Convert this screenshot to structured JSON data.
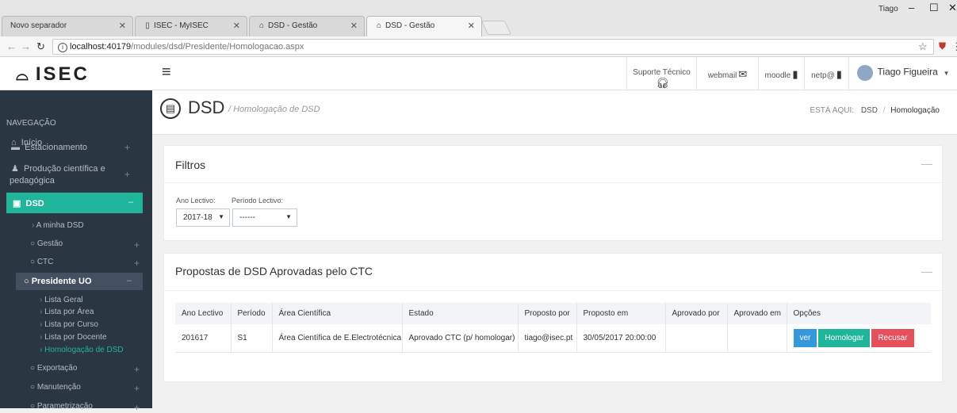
{
  "browser": {
    "tabs": [
      {
        "label": "Novo separador",
        "icon": ""
      },
      {
        "label": "ISEC - MyISEC",
        "icon": "page-icon"
      },
      {
        "label": "DSD - Gestão",
        "icon": "isec-logo-icon"
      },
      {
        "label": "DSD - Gestão",
        "icon": "isec-logo-icon"
      }
    ],
    "window_user": "Tiago",
    "url_host": "localhost:40179",
    "url_path": "/modules/dsd/Presidente/Homologacao.aspx"
  },
  "header": {
    "logo_text": "ISEC",
    "suporte": "Suporte Técnico",
    "webmail": "webmail",
    "moodle": "moodle",
    "netp": "netp@",
    "user_name": "Tiago Figueira"
  },
  "sidebar": {
    "heading": "NAVEGAÇÃO",
    "inicio": "Início",
    "estacionamento": "Estacionamento",
    "producao_line1": "Produção científica e",
    "producao_line2": "pedagógica",
    "dsd": "DSD",
    "minha_dsd": "A minha DSD",
    "gestao": "Gestão",
    "ctc": "CTC",
    "presidente": "Presidente UO",
    "sub": [
      "Lista Geral",
      "Lista por Área",
      "Lista por Curso",
      "Lista por Docente",
      "Homologação de DSD"
    ],
    "exportacao": "Exportação",
    "manutencao": "Manutenção",
    "parametrizacao": "Parametrização"
  },
  "page": {
    "title": "DSD",
    "subtitle": "/  Homologação de DSD",
    "crumb_label": "ESTÁ AQUI:",
    "crumb_dsd": "DSD",
    "crumb_current": "Homologação"
  },
  "filtros": {
    "title": "Filtros",
    "ano_label": "Ano Lectivo:",
    "ano_value": "2017-18",
    "periodo_label": "Período Lectivo:",
    "periodo_value": "------"
  },
  "propostas": {
    "title": "Propostas de DSD Aprovadas pelo CTC",
    "columns": [
      "Ano Lectivo",
      "Período",
      "Área Científica",
      "Estado",
      "Proposto por",
      "Proposto em",
      "Aprovado por",
      "Aprovado em",
      "Opções"
    ],
    "rows": [
      [
        "201617",
        "S1",
        "Área Científica de E.Electrotécnica",
        "Aprovado CTC (p/ homologar)",
        "tiago@isec.pt",
        "30/05/2017 20:00:00",
        "",
        ""
      ]
    ],
    "btn_ver": "ver",
    "btn_homologar": "Homologar",
    "btn_recusar": "Recusar"
  }
}
